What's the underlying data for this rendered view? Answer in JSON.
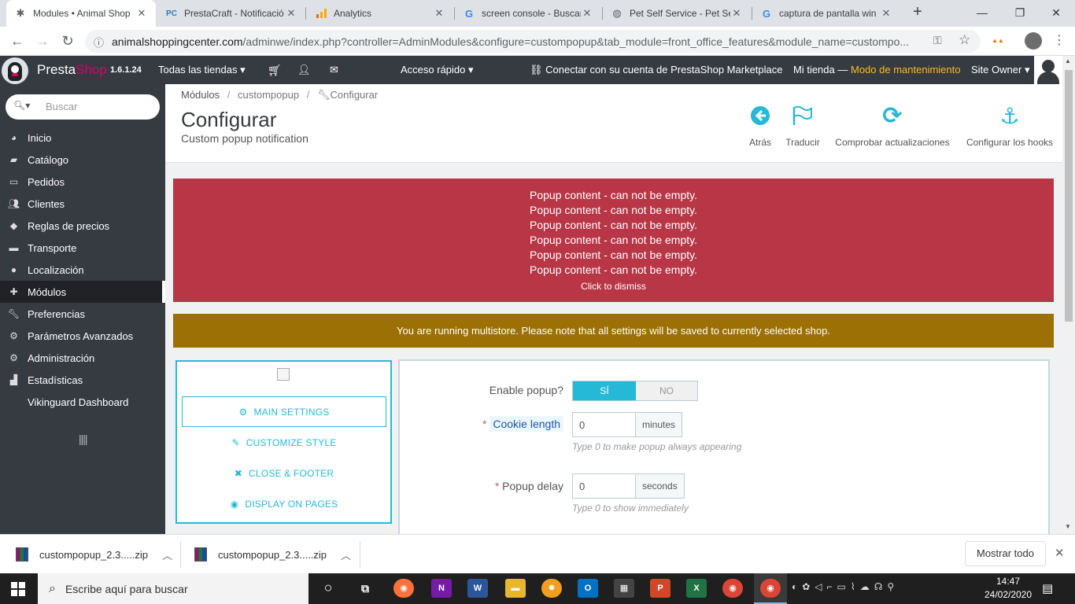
{
  "browser": {
    "tabs": [
      {
        "title": "Modules • Animal Shop",
        "favicon": "paw-icon",
        "active": true
      },
      {
        "title": "PrestaCraft - Notificació",
        "favicon": "PC",
        "active": false
      },
      {
        "title": "Analytics",
        "favicon": "analytics-icon",
        "active": false
      },
      {
        "title": "screen console - Buscar",
        "favicon": "google-icon",
        "active": false
      },
      {
        "title": "Pet Self Service - Pet Se",
        "favicon": "globe-icon",
        "active": false
      },
      {
        "title": "captura de pantalla win",
        "favicon": "google-icon",
        "active": false
      }
    ],
    "url_host": "animalshoppingcenter.com",
    "url_path": "/adminwe/index.php?controller=AdminModules&configure=custompopup&tab_module=front_office_features&module_name=custompo..."
  },
  "header": {
    "brand_presta": "Presta",
    "brand_shop": "Shop",
    "version": "1.6.1.24",
    "shops_dropdown": "Todas las tiendas",
    "quick_access": "Acceso rápido",
    "marketplace_link": "Conectar con su cuenta de PrestaShop Marketplace",
    "my_shop": "Mi tienda —",
    "maintenance": "Modo de mantenimiento",
    "user": "Site Owner"
  },
  "sidebar": {
    "search_placeholder": "Buscar",
    "items": [
      {
        "label": "Inicio",
        "icon": "dashboard-icon"
      },
      {
        "label": "Catálogo",
        "icon": "book-icon"
      },
      {
        "label": "Pedidos",
        "icon": "credit-card-icon"
      },
      {
        "label": "Clientes",
        "icon": "users-icon"
      },
      {
        "label": "Reglas de precios",
        "icon": "tags-icon"
      },
      {
        "label": "Transporte",
        "icon": "truck-icon"
      },
      {
        "label": "Localización",
        "icon": "globe-icon"
      },
      {
        "label": "Módulos",
        "icon": "puzzle-icon",
        "active": true
      },
      {
        "label": "Preferencias",
        "icon": "wrench-icon"
      },
      {
        "label": "Parámetros Avanzados",
        "icon": "cogs-icon"
      },
      {
        "label": "Administración",
        "icon": "cog-icon"
      },
      {
        "label": "Estadísticas",
        "icon": "bar-chart-icon"
      },
      {
        "label": "Vikinguard Dashboard",
        "icon": ""
      }
    ]
  },
  "page": {
    "breadcrumb": [
      "Módulos",
      "custompopup",
      "Configurar"
    ],
    "title": "Configurar",
    "subtitle": "Custom popup notification",
    "toolbar": [
      {
        "label": "Atrás",
        "icon": "arrow-left-circle-icon"
      },
      {
        "label": "Traducir",
        "icon": "flag-icon"
      },
      {
        "label": "Comprobar actualizaciones",
        "icon": "refresh-icon"
      },
      {
        "label": "Configurar los hooks",
        "icon": "anchor-icon"
      }
    ]
  },
  "errors": {
    "lines": [
      "Popup content - can not be empty.",
      "Popup content - can not be empty.",
      "Popup content - can not be empty.",
      "Popup content - can not be empty.",
      "Popup content - can not be empty.",
      "Popup content - can not be empty."
    ],
    "dismiss": "Click to dismiss"
  },
  "warning": "You are running multistore. Please note that all settings will be saved to currently selected shop.",
  "module_tabs": [
    {
      "label": "MAIN SETTINGS",
      "icon": "cogs-icon",
      "selected": true
    },
    {
      "label": "CUSTOMIZE STYLE",
      "icon": "pencil-icon"
    },
    {
      "label": "CLOSE & FOOTER",
      "icon": "close-icon"
    },
    {
      "label": "DISPLAY ON PAGES",
      "icon": "eye-icon"
    }
  ],
  "form": {
    "enable_popup": {
      "label": "Enable popup?",
      "yes": "SÍ",
      "no": "NO",
      "value": "yes"
    },
    "cookie_length": {
      "label": "Cookie length",
      "value": "0",
      "addon": "minutes",
      "help": "Type 0 to make popup always appearing"
    },
    "popup_delay": {
      "label": "Popup delay",
      "value": "0",
      "addon": "seconds",
      "help": "Type 0 to show immediately"
    }
  },
  "downloads": {
    "items": [
      "custompopup_2.3.....zip",
      "custompopup_2.3.....zip"
    ],
    "show_all": "Mostrar todo"
  },
  "taskbar": {
    "search_placeholder": "Escribe aquí para buscar",
    "time": "14:47",
    "date": "24/02/2020"
  },
  "colors": {
    "ps_dark": "#363a41",
    "accent": "#25b9d7",
    "error": "#b83646",
    "warning": "#9c7004",
    "maintenance": "#fbbb22"
  }
}
